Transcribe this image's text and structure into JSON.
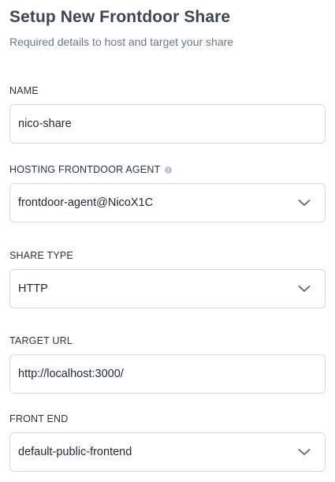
{
  "header": {
    "title": "Setup New Frontdoor Share",
    "subtitle": "Required details to host and target your share"
  },
  "fields": {
    "name": {
      "label": "NAME",
      "value": "nico-share"
    },
    "agent": {
      "label": "HOSTING FRONTDOOR AGENT",
      "value": "frontdoor-agent@NicoX1C",
      "info_icon": "info-icon"
    },
    "share_type": {
      "label": "SHARE TYPE",
      "value": "HTTP"
    },
    "target_url": {
      "label": "TARGET URL",
      "value": "http://localhost:3000/"
    },
    "front_end": {
      "label": "FRONT END",
      "value": "default-public-frontend"
    }
  },
  "icons": {
    "dropdown": "chevron-down-icon",
    "info": "info-icon"
  },
  "colors": {
    "title": "#3c4654",
    "border": "#d4dae1",
    "chevron": "#5a6675"
  }
}
